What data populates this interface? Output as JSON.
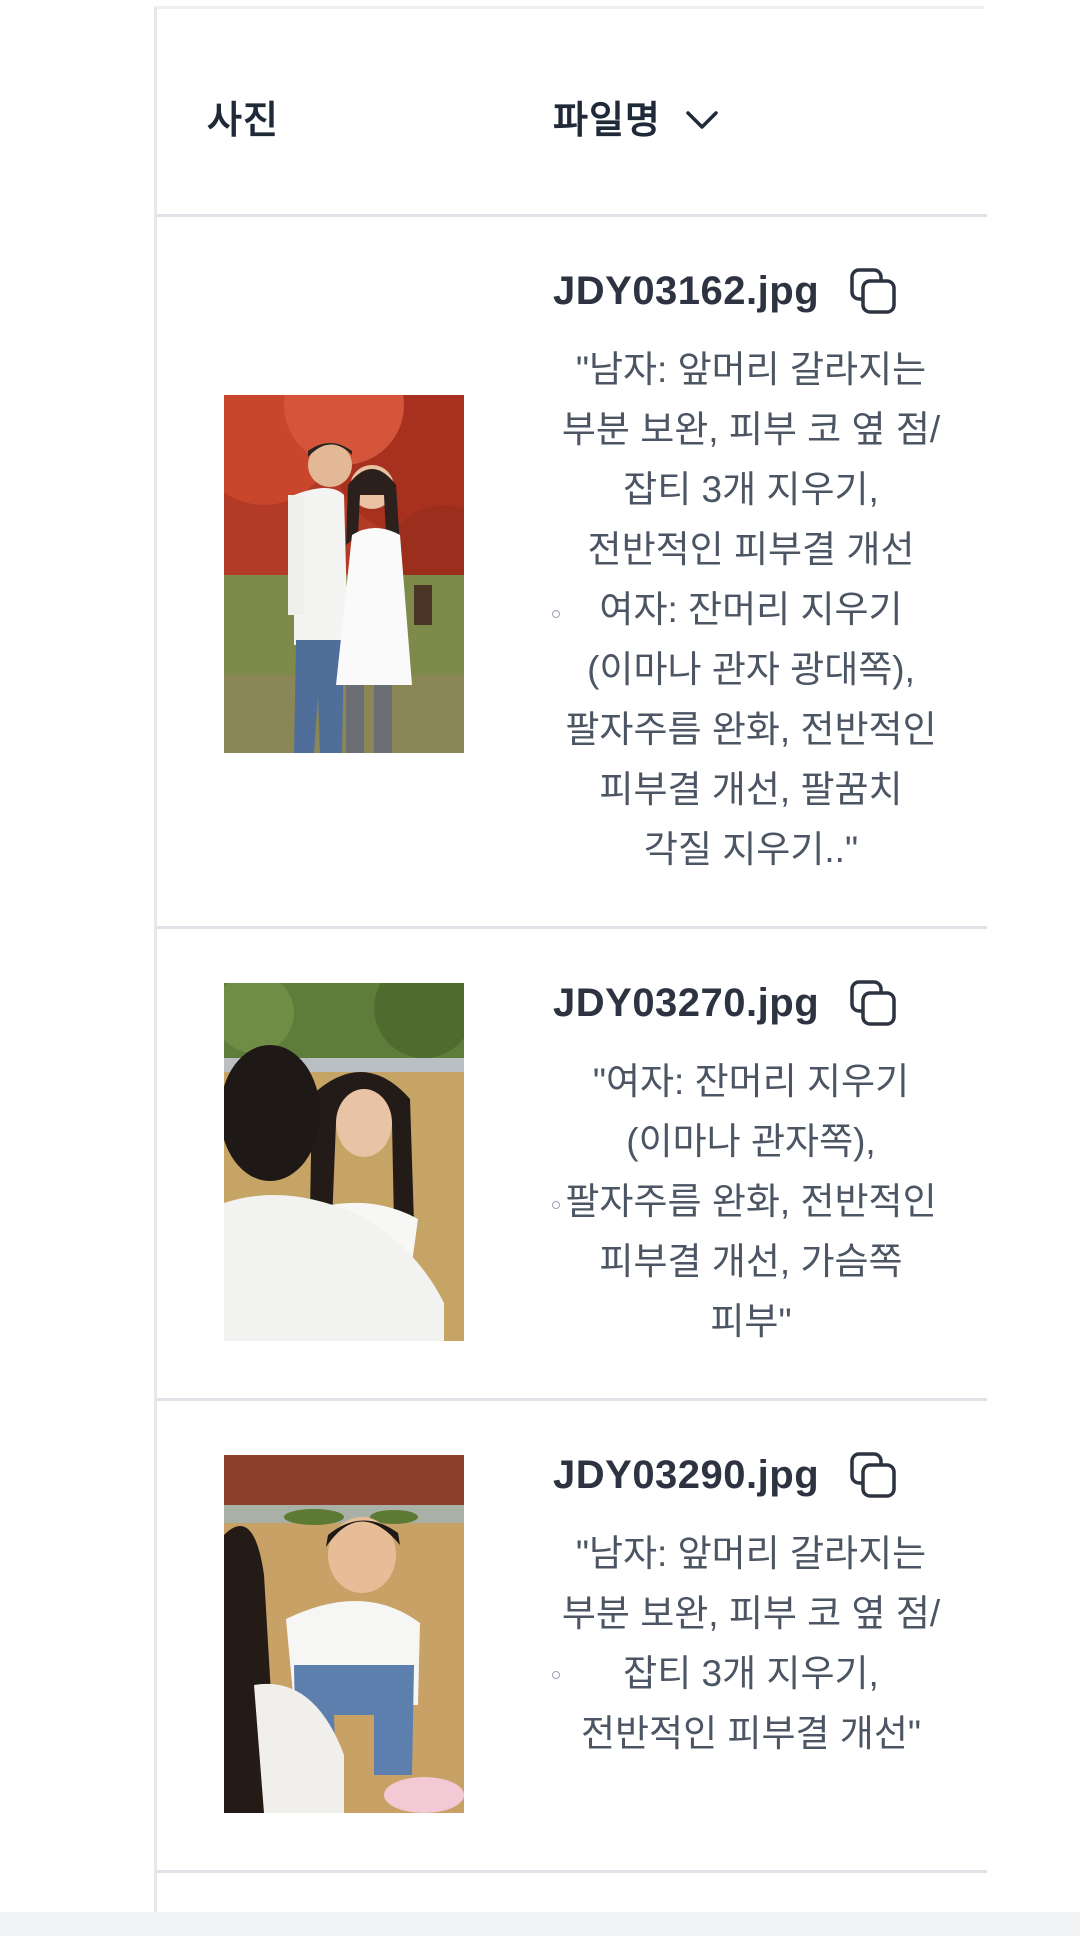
{
  "table": {
    "headers": {
      "photo": "사진",
      "filename": "파일명"
    },
    "rows": [
      {
        "filename": "JDY03162.jpg",
        "note": "\"남자: 앞머리 갈라지는 부분 보완, 피부 코 옆 점/잡티 3개 지우기, 전반적인 피부결 개선 여자: 잔머리 지우기 (이마나 관자 광대쪽), 팔자주름 완화, 전반적인 피부결 개선, 팔꿈치 각질 지우기..\""
      },
      {
        "filename": "JDY03270.jpg",
        "note": "\"여자: 잔머리 지우기 (이마나 관자쪽), 팔자주름 완화, 전반적인 피부결 개선, 가슴쪽 피부\""
      },
      {
        "filename": "JDY03290.jpg",
        "note": "\"남자: 앞머리 갈라지는 부분 보완, 피부 코 옆 점/잡티 3개 지우기, 전반적인 피부결 개선\""
      }
    ]
  },
  "icons": {
    "sort": "chevron-down-icon",
    "copy": "copy-icon"
  },
  "colors": {
    "text_primary": "#1f2937",
    "text_secondary": "#4b5563",
    "border": "#dfe2e6"
  }
}
